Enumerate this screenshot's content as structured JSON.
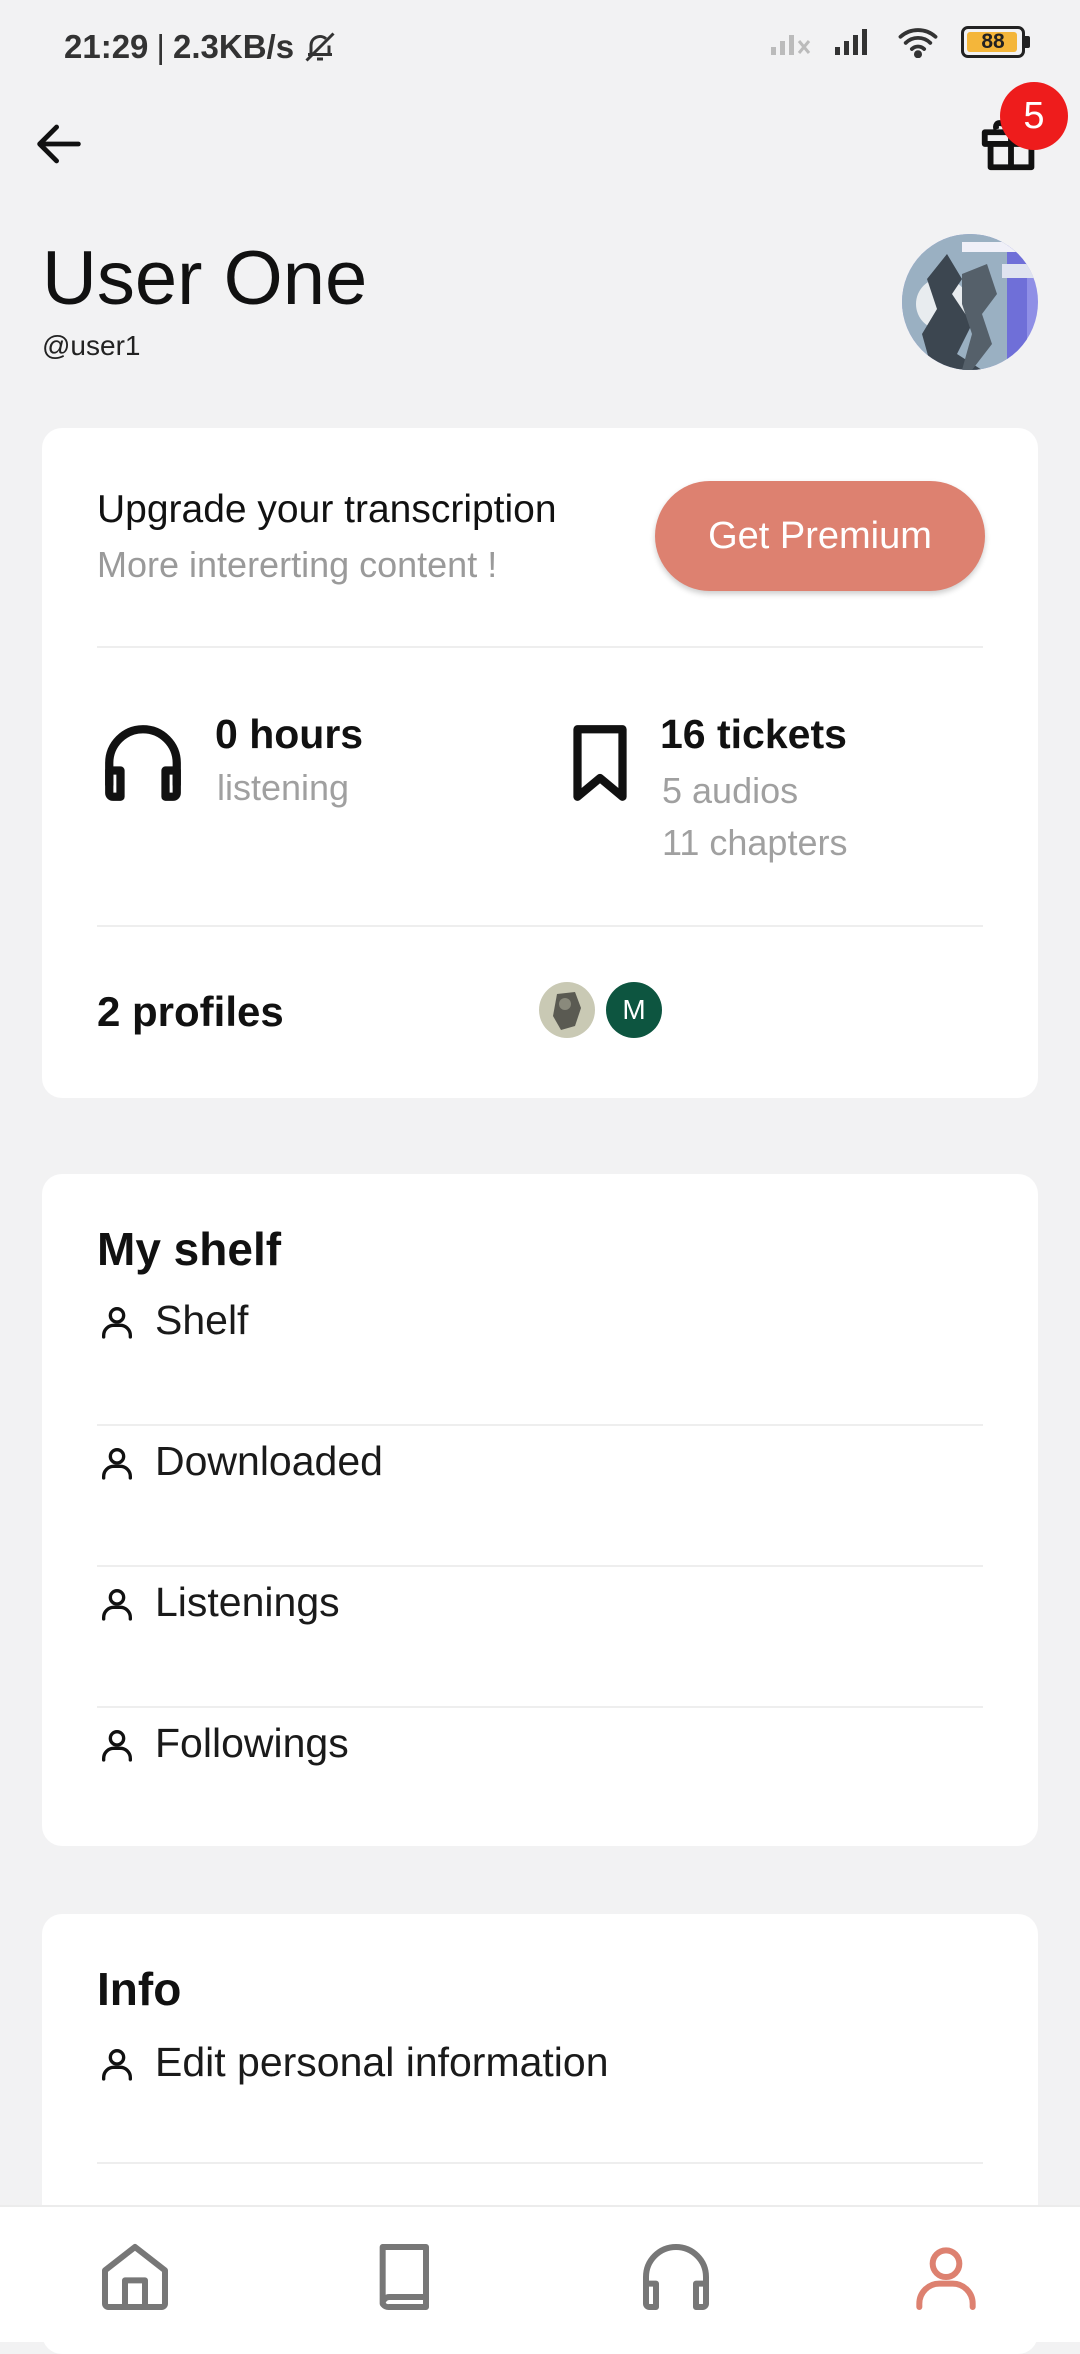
{
  "status_bar": {
    "time": "21:29",
    "separator": "|",
    "net_speed": "2.3KB/s",
    "battery_level": "88",
    "battery_color": "#f4b63a"
  },
  "header": {
    "notification_count": "5",
    "badge_color": "#ee1c1c"
  },
  "profile": {
    "name": "User One",
    "handle": "@user1"
  },
  "premium": {
    "title": "Upgrade your transcription",
    "subtitle": "More intererting content !",
    "button_label": "Get Premium",
    "button_color": "#dd8170"
  },
  "stats": {
    "listening_value": "0 hours",
    "listening_label": "listening",
    "tickets_value": "16 tickets",
    "tickets_audios": "5 audios",
    "tickets_chapters": "11 chapters"
  },
  "profiles": {
    "label": "2 profiles",
    "second_initial": "M"
  },
  "shelf": {
    "title": "My shelf",
    "items": [
      {
        "label": "Shelf",
        "icon": "person-icon"
      },
      {
        "label": "Downloaded",
        "icon": "person-icon"
      },
      {
        "label": "Listenings",
        "icon": "person-icon"
      },
      {
        "label": "Followings",
        "icon": "person-icon"
      }
    ]
  },
  "info": {
    "title": "Info",
    "items": [
      {
        "label": "Edit personal information",
        "icon": "person-icon"
      }
    ]
  },
  "bottom_nav": {
    "items": [
      {
        "icon": "home-icon"
      },
      {
        "icon": "book-icon"
      },
      {
        "icon": "headphones-icon"
      },
      {
        "icon": "person-icon",
        "active": true
      }
    ],
    "active_color": "#dd8170"
  }
}
